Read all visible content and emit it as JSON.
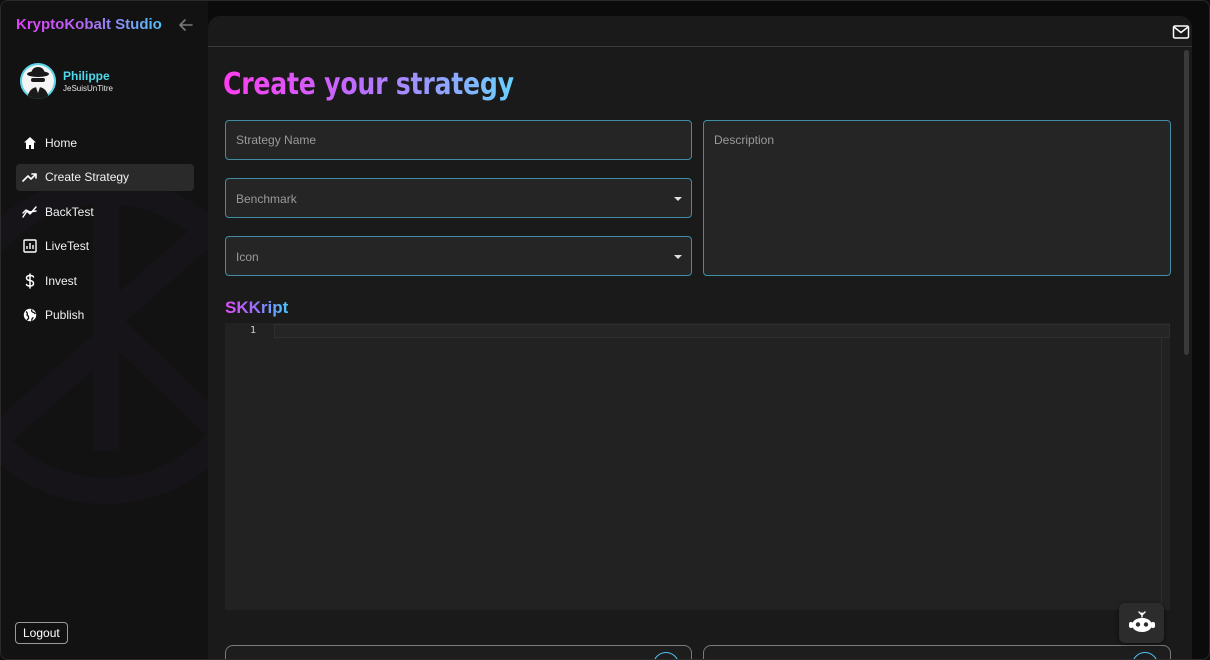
{
  "app": {
    "brand": "KryptoKobalt Studio"
  },
  "user": {
    "name": "Philippe",
    "handle": "JeSuisUnTitre"
  },
  "sidebar": {
    "items": [
      {
        "label": "Home",
        "icon": "home-icon",
        "active": false
      },
      {
        "label": "Create Strategy",
        "icon": "trending-up-icon",
        "active": true
      },
      {
        "label": "BackTest",
        "icon": "chart-line-icon",
        "active": false
      },
      {
        "label": "LiveTest",
        "icon": "bar-chart-icon",
        "active": false
      },
      {
        "label": "Invest",
        "icon": "dollar-icon",
        "active": false
      },
      {
        "label": "Publish",
        "icon": "globe-icon",
        "active": false
      }
    ],
    "logout_label": "Logout"
  },
  "main": {
    "title": "Create your strategy",
    "form": {
      "strategy_name_placeholder": "Strategy Name",
      "benchmark_placeholder": "Benchmark",
      "icon_placeholder": "Icon",
      "description_placeholder": "Description"
    },
    "editor": {
      "title": "SKKript",
      "line_numbers": [
        "1"
      ],
      "content": ""
    }
  },
  "colors": {
    "accent_cyan": "#4fd8ec",
    "accent_magenta": "#e040fb",
    "field_border": "#3f8ea6"
  }
}
